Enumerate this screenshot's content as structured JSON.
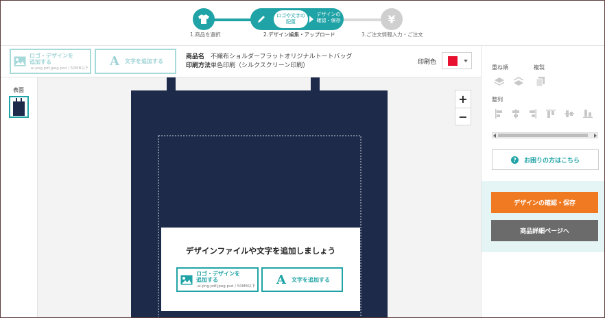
{
  "stepper": {
    "steps": [
      {
        "label": "1.商品を選択",
        "icon": "tshirt-icon"
      },
      {
        "label": "2.デザイン編集・アップロード",
        "icon": "pencil-icon",
        "sub_a": "ロゴや文字の\n配置",
        "sub_b": "デザインの\n確認・保存"
      },
      {
        "label": "3.ご注文情報入力・ご注文",
        "icon": "yen-icon"
      }
    ],
    "active_color": "#20a3a6",
    "inactive_color": "#cfcfcf"
  },
  "toolbar": {
    "add_logo_label": "ロゴ・デザインを\n追加する",
    "add_logo_formats": ".ai.png.pdf.jpeg.psd / 50MB以下",
    "add_text_label": "文字を追加する",
    "product_name_key": "商品名",
    "product_name": "不織布ショルダーフラットオリジナルトートバッグ",
    "print_method_key": "印刷方法",
    "print_method": "単色印刷（シルクスクリーン印刷）",
    "print_color_label": "印刷色",
    "print_color": "#e8102f"
  },
  "thumbs": {
    "side_label": "表面"
  },
  "canvas": {
    "bag_color": "#1d2a4a",
    "zoom_in": "+",
    "zoom_out": "−",
    "prompt_title": "デザインファイルや文字を追加しましょう",
    "add_logo_label": "ロゴ・デザインを\n追加する",
    "add_logo_formats": ".ai.png.pdf.jpeg.psd / 50MB以下",
    "add_text_label": "文字を追加する"
  },
  "sidebar": {
    "order_label": "重ね順",
    "duplicate_label": "複製",
    "align_label": "整列",
    "help_label": "お困りの方はこちら",
    "confirm_save_label": "デザインの確認・保存",
    "product_detail_label": "商品詳細ページへ",
    "accent_orange": "#f07a21"
  }
}
